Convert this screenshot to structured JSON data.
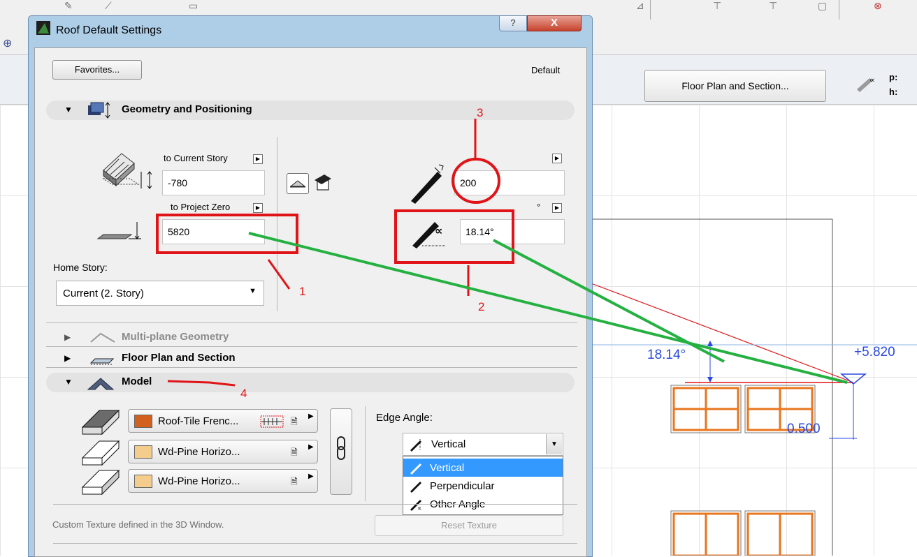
{
  "dialog": {
    "title": "Roof Default Settings",
    "help_label": "?",
    "close_label": "X",
    "favorites_label": "Favorites...",
    "default_label": "Default"
  },
  "sections": {
    "geometry": "Geometry and Positioning",
    "multiplane": "Multi-plane Geometry",
    "floorplan": "Floor Plan and Section",
    "model": "Model"
  },
  "geometry": {
    "to_current_story_label": "to Current Story",
    "to_current_story_value": "-780",
    "to_project_zero_label": "to Project Zero",
    "to_project_zero_value": "5820",
    "home_story_label": "Home Story:",
    "home_story_value": "Current (2. Story)",
    "thickness_value": "200",
    "angle_unit": "°",
    "angle_value": "18.14°"
  },
  "model": {
    "materials": [
      {
        "name": "Roof-Tile Frenc...",
        "color": "#d2601e"
      },
      {
        "name": "Wd-Pine Horizo...",
        "color": "#f4cc8c"
      },
      {
        "name": "Wd-Pine Horizo...",
        "color": "#f4cc8c"
      }
    ],
    "edge_angle_label": "Edge Angle:",
    "edge_angle_value": "Vertical",
    "edge_angle_options": [
      "Vertical",
      "Perpendicular",
      "Other Angle"
    ],
    "custom_texture_text": "Custom Texture defined in the 3D Window.",
    "reset_texture_label": "Reset Texture"
  },
  "background": {
    "fps_button_label": "Floor Plan and Section...",
    "p_label": "p:",
    "h_label": "h:",
    "dim_angle": "18.14°",
    "dim_elevation": "+5.820",
    "dim_height": "0.500"
  },
  "annotations": {
    "n1": "1",
    "n2": "2",
    "n3": "3",
    "n4": "4"
  },
  "colors": {
    "annotation_red": "#e01418",
    "annotation_green": "#25b142",
    "dimension_blue": "#2a49e0",
    "window_orange": "#e8761e",
    "selection_blue": "#3399ff"
  }
}
